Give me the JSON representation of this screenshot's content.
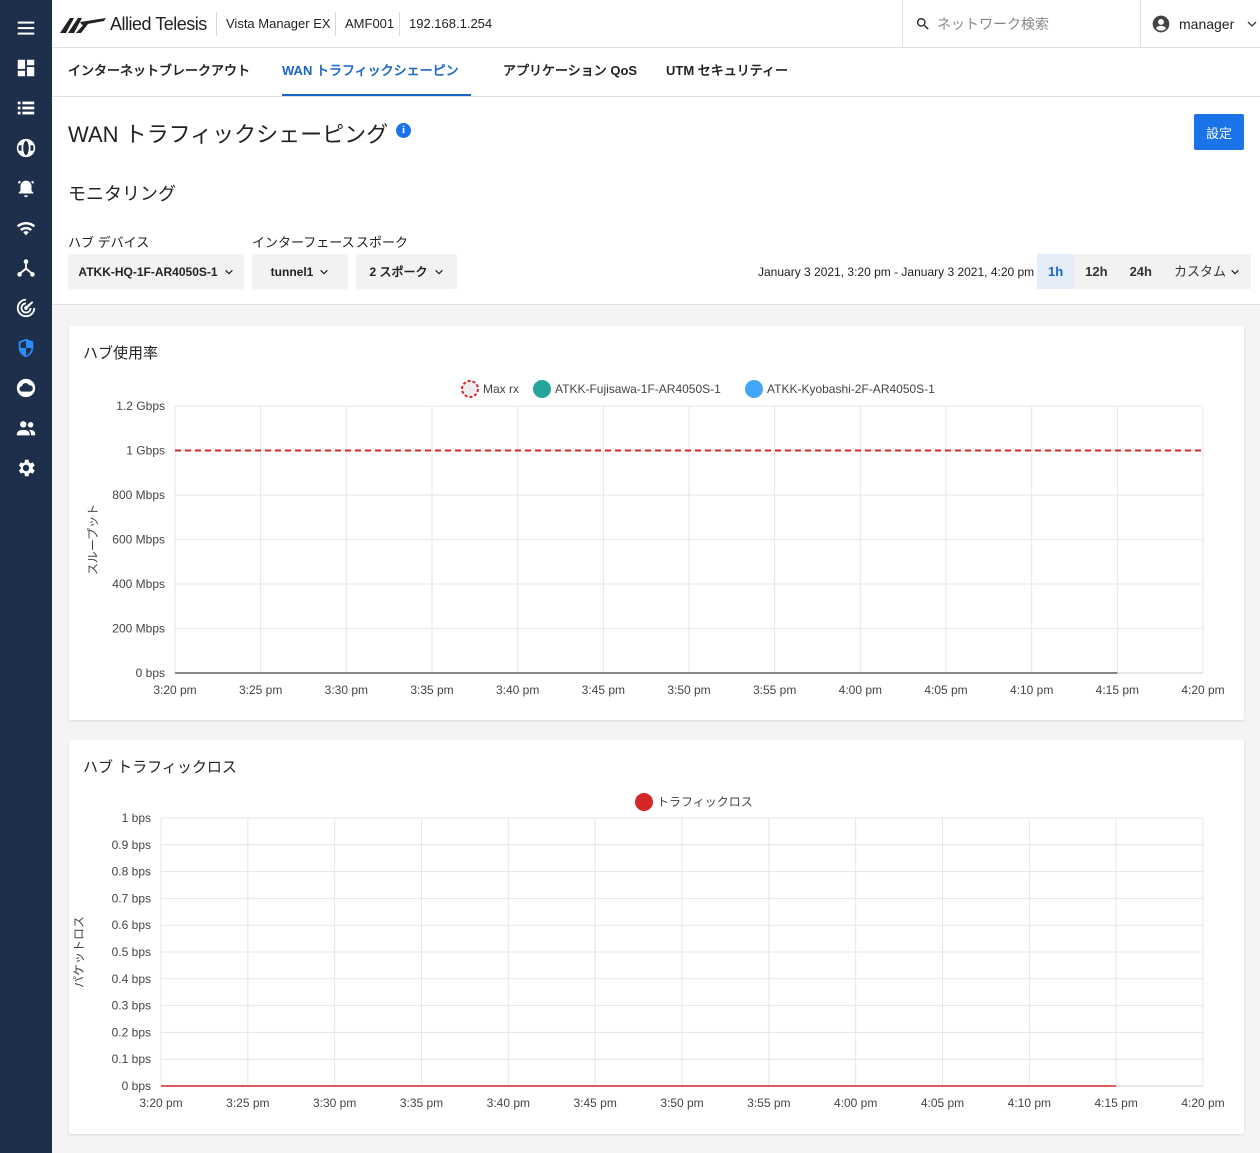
{
  "app": {
    "brand": "Allied Telesis",
    "product": "Vista Manager EX",
    "network": "AMF001",
    "ip": "192.168.1.254"
  },
  "search": {
    "placeholder": "ネットワーク検索"
  },
  "user": {
    "name": "manager"
  },
  "sidebar": {
    "items": [
      "dashboard-icon",
      "list-icon",
      "globe-icon",
      "alarm-icon",
      "wifi-icon",
      "topology-icon",
      "radar-icon",
      "shield-icon",
      "cloud-icon",
      "people-icon",
      "gear-icon"
    ]
  },
  "tabs": [
    {
      "label": "インターネットブレークアウト",
      "active": false
    },
    {
      "label": "WAN トラフィックシェーピング",
      "active": true
    },
    {
      "label": "アプリケーション QoS",
      "active": false
    },
    {
      "label": "UTM セキュリティー",
      "active": false
    }
  ],
  "page": {
    "title": "WAN トラフィックシェーピング",
    "settings_label": "設定",
    "section_title": "モニタリング"
  },
  "filters": {
    "hub_device": {
      "label": "ハブ デバイス",
      "value": "ATKK-HQ-1F-AR4050S-1"
    },
    "interface": {
      "label": "インターフェース",
      "value": "tunnel1"
    },
    "spoke": {
      "label": "スポーク",
      "value": "2 スポーク"
    },
    "date_range": "January 3 2021, 3:20 pm - January 3 2021, 4:20 pm",
    "time_options": [
      "1h",
      "12h",
      "24h"
    ],
    "time_selected": "1h",
    "custom_label": "カスタム"
  },
  "colors": {
    "accent": "#1a73e8",
    "sidebar": "#1d2f4a",
    "max_rx": "#d62728",
    "fujisawa": "#26a69a",
    "kyobashi": "#42a5f5",
    "loss": "#d62728"
  },
  "chart_data": [
    {
      "type": "line",
      "title": "ハブ使用率",
      "ylabel": "スループット",
      "x": [
        "3:20 pm",
        "3:25 pm",
        "3:30 pm",
        "3:35 pm",
        "3:40 pm",
        "3:45 pm",
        "3:50 pm",
        "3:55 pm",
        "4:00 pm",
        "4:05 pm",
        "4:10 pm",
        "4:15 pm",
        "4:20 pm"
      ],
      "yticks": [
        "0 bps",
        "200 Mbps",
        "400 Mbps",
        "600 Mbps",
        "800 Mbps",
        "1 Gbps",
        "1.2 Gbps"
      ],
      "ylim": [
        0,
        1.2
      ],
      "yunit": "Gbps",
      "grid": true,
      "legend": "top-center",
      "series": [
        {
          "name": "Max rx",
          "style": "dashed",
          "values": [
            1,
            1,
            1,
            1,
            1,
            1,
            1,
            1,
            1,
            1,
            1,
            1,
            1
          ]
        },
        {
          "name": "ATKK-Fujisawa-1F-AR4050S-1",
          "values": [
            0,
            0,
            0,
            0,
            0,
            0,
            0,
            0,
            0,
            0,
            0,
            0
          ]
        },
        {
          "name": "ATKK-Kyobashi-2F-AR4050S-1",
          "values": [
            0,
            0,
            0,
            0,
            0,
            0,
            0,
            0,
            0,
            0,
            0,
            0
          ]
        }
      ]
    },
    {
      "type": "line",
      "title": "ハブ トラフィックロス",
      "ylabel": "パケットロス",
      "x": [
        "3:20 pm",
        "3:25 pm",
        "3:30 pm",
        "3:35 pm",
        "3:40 pm",
        "3:45 pm",
        "3:50 pm",
        "3:55 pm",
        "4:00 pm",
        "4:05 pm",
        "4:10 pm",
        "4:15 pm",
        "4:20 pm"
      ],
      "yticks": [
        "0 bps",
        "0.1 bps",
        "0.2 bps",
        "0.3 bps",
        "0.4 bps",
        "0.5 bps",
        "0.6 bps",
        "0.7 bps",
        "0.8 bps",
        "0.9 bps",
        "1 bps"
      ],
      "ylim": [
        0,
        1
      ],
      "yunit": "bps",
      "grid": true,
      "legend": "top-center",
      "series": [
        {
          "name": "トラフィックロス",
          "values": [
            0,
            0,
            0,
            0,
            0,
            0,
            0,
            0,
            0,
            0,
            0,
            0
          ]
        }
      ]
    }
  ]
}
